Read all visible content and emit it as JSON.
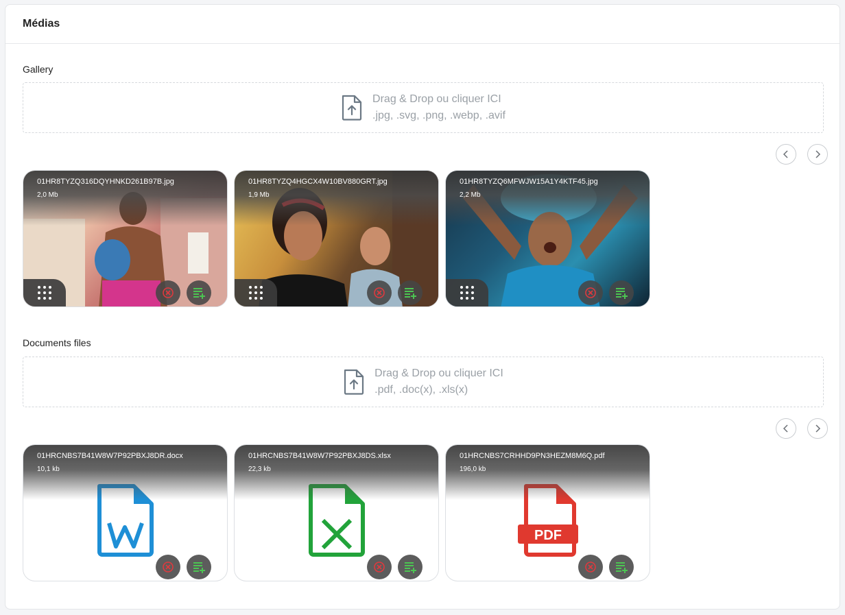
{
  "panel": {
    "title": "Médias"
  },
  "gallery": {
    "title": "Gallery",
    "dropzone": {
      "line1": "Drag & Drop ou cliquer ICI",
      "line2": ".jpg, .svg, .png, .webp, .avif"
    },
    "items": [
      {
        "name": "01HR8TYZQ316DQYHNKD261B97B.jpg",
        "size": "2,0 Mb"
      },
      {
        "name": "01HR8TYZQ4HGCX4W10BV880GRT.jpg",
        "size": "1,9 Mb"
      },
      {
        "name": "01HR8TYZQ6MFWJW15A1Y4KTF45.jpg",
        "size": "2,2 Mb"
      }
    ]
  },
  "documents": {
    "title": "Documents files",
    "dropzone": {
      "line1": "Drag & Drop ou cliquer ICI",
      "line2": ".pdf, .doc(x), .xls(x)"
    },
    "items": [
      {
        "name": "01HRCNBS7B41W8W7P92PBXJ8DR.docx",
        "size": "10,1 kb",
        "icon": "word-file-icon",
        "color": "#1e8fd6"
      },
      {
        "name": "01HRCNBS7B41W8W7P92PBXJ8DS.xlsx",
        "size": "22,3 kb",
        "icon": "excel-file-icon",
        "color": "#22a33a"
      },
      {
        "name": "01HRCNBS7CRHHD9PN3HEZM8M6Q.pdf",
        "size": "196,0 kb",
        "icon": "pdf-file-icon",
        "color": "#e0392f",
        "badge": "PDF"
      }
    ]
  },
  "colors": {
    "delete": "#e0393e",
    "add": "#4cc552"
  }
}
